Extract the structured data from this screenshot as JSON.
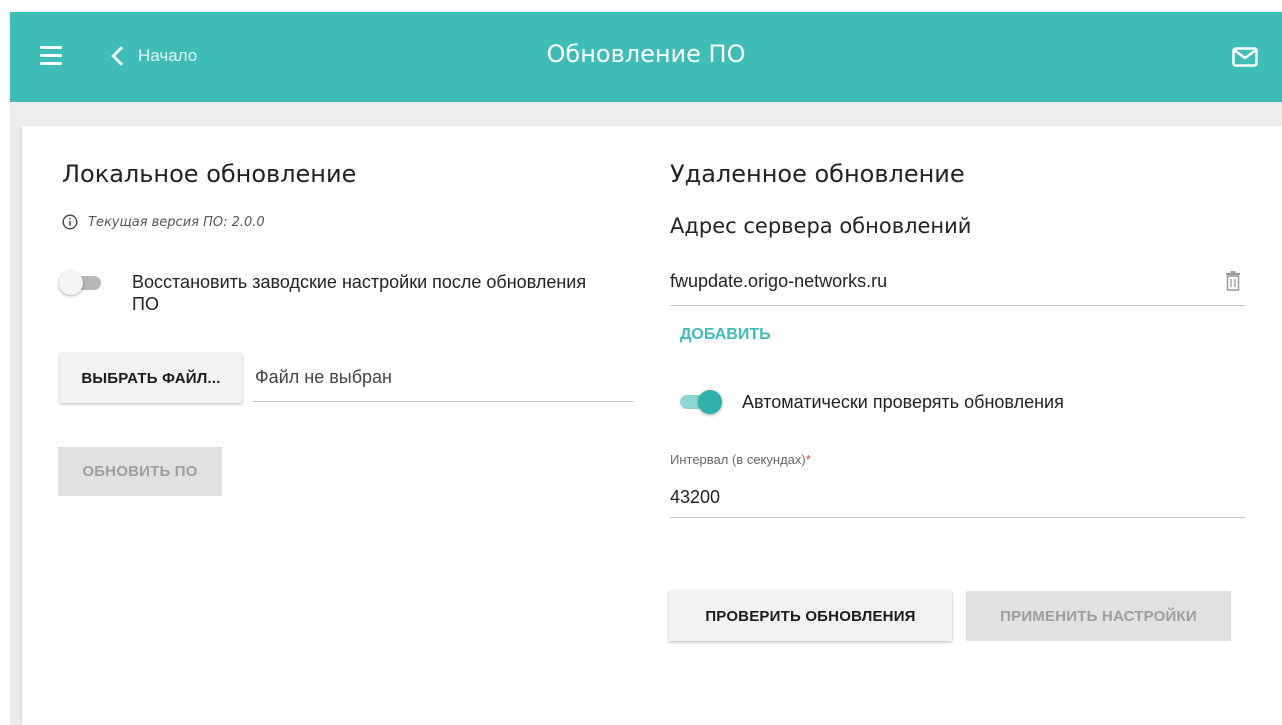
{
  "header": {
    "back_label": "Начало",
    "title": "Обновление ПО",
    "accent_color": "#3dbcb8",
    "icons": [
      "menu-icon",
      "chevron-left-icon",
      "mail-icon"
    ]
  },
  "local": {
    "title": "Локальное обновление",
    "version_text": "Текущая версия ПО: 2.0.0",
    "reset_toggle": {
      "label": "Восстановить заводские настройки после обновления ПО",
      "checked": false
    },
    "choose_file_label": "ВЫБРАТЬ ФАЙЛ...",
    "file_status": "Файл не выбран",
    "update_button_label": "ОБНОВИТЬ ПО"
  },
  "remote": {
    "title": "Удаленное обновление",
    "server_heading": "Адрес сервера обновлений",
    "server_value": "fwupdate.origo-networks.ru",
    "add_label": "ДОБАВИТЬ",
    "auto_check_toggle": {
      "label": "Автоматически проверять обновления",
      "checked": true
    },
    "interval_label": "Интервал (в секундах)",
    "interval_required_mark": "*",
    "interval_value": "43200",
    "check_button_label": "ПРОВЕРИТЬ ОБНОВЛЕНИЯ",
    "apply_button_label": "ПРИМЕНИТЬ НАСТРОЙКИ"
  }
}
